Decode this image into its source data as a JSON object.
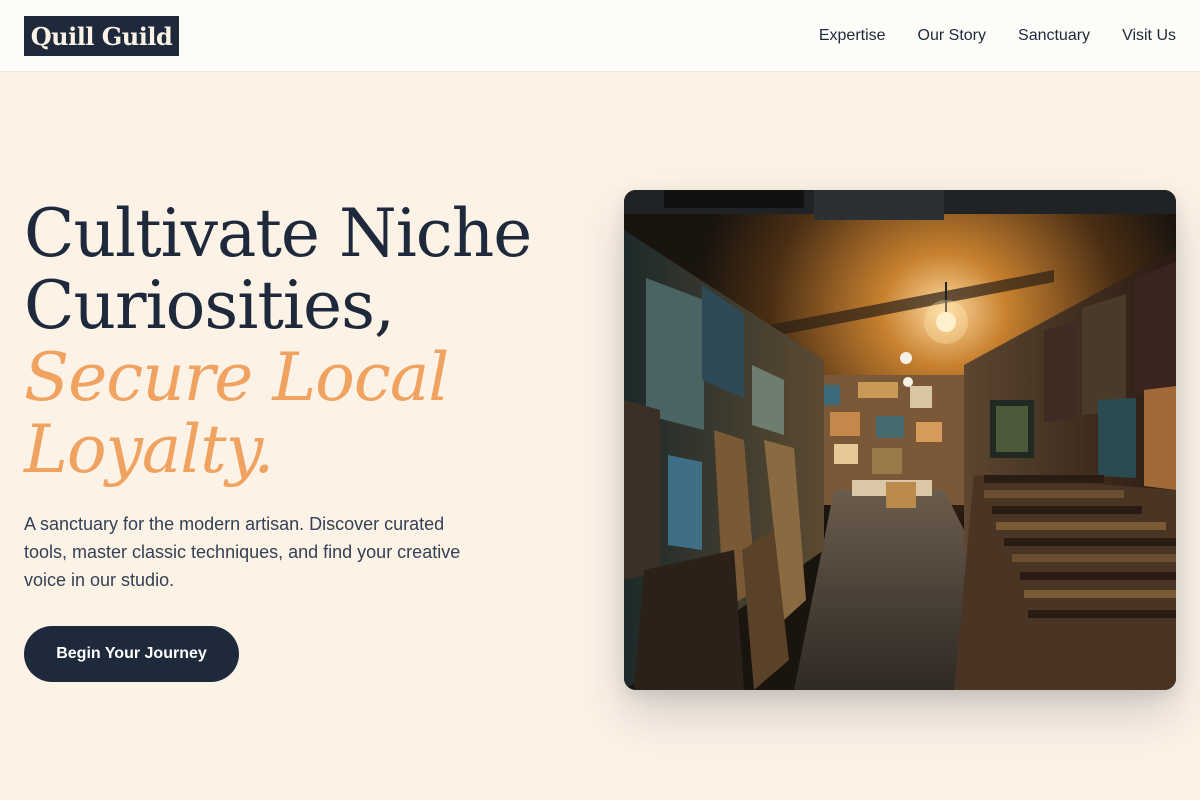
{
  "header": {
    "logo": "Quill Guild",
    "nav": [
      {
        "label": "Expertise"
      },
      {
        "label": "Our Story"
      },
      {
        "label": "Sanctuary"
      },
      {
        "label": "Visit Us"
      }
    ]
  },
  "hero": {
    "title_lines": [
      "Cultivate Niche",
      "Curiosities,"
    ],
    "accent_lines": [
      "Secure Local",
      "Loyalty."
    ],
    "description": "A sanctuary for the modern artisan. Discover curated tools, master classic techniques, and find your creative voice in our studio.",
    "cta_label": "Begin Your Journey",
    "image": {
      "icon": "gallery-photo",
      "alt": ""
    }
  },
  "colors": {
    "background": "#fdf2e6",
    "header": "#fefcf8",
    "navy": "#1e293b",
    "accent": "#f0a361"
  }
}
